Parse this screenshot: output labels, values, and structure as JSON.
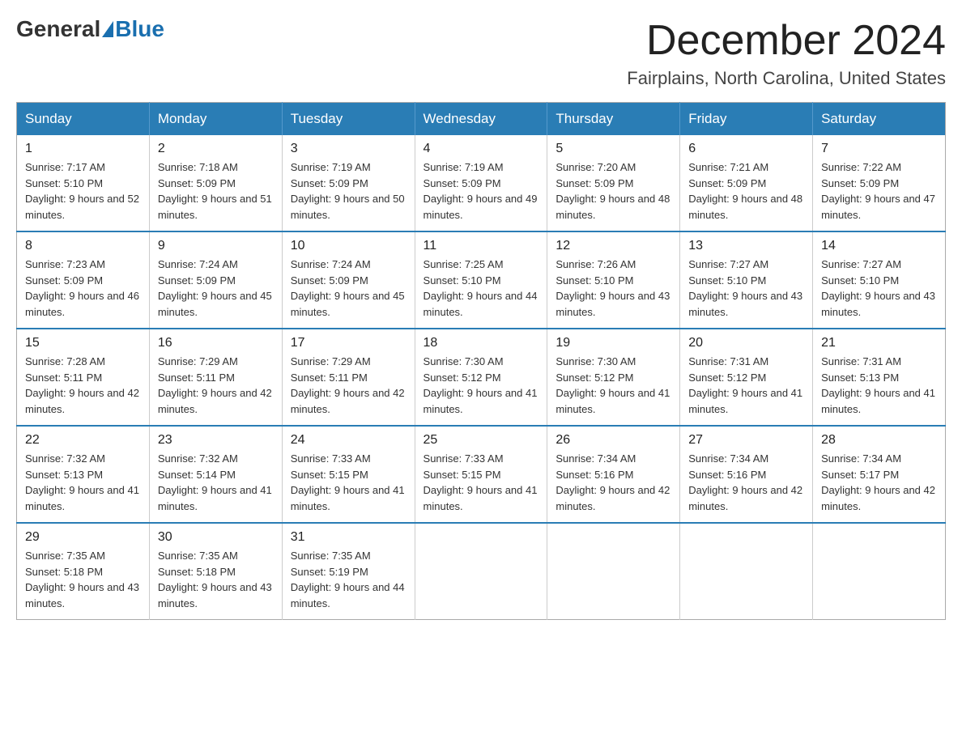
{
  "logo": {
    "general": "General",
    "blue": "Blue"
  },
  "title": {
    "month_year": "December 2024",
    "location": "Fairplains, North Carolina, United States"
  },
  "days_of_week": [
    "Sunday",
    "Monday",
    "Tuesday",
    "Wednesday",
    "Thursday",
    "Friday",
    "Saturday"
  ],
  "weeks": [
    [
      {
        "day": "1",
        "sunrise": "7:17 AM",
        "sunset": "5:10 PM",
        "daylight": "9 hours and 52 minutes."
      },
      {
        "day": "2",
        "sunrise": "7:18 AM",
        "sunset": "5:09 PM",
        "daylight": "9 hours and 51 minutes."
      },
      {
        "day": "3",
        "sunrise": "7:19 AM",
        "sunset": "5:09 PM",
        "daylight": "9 hours and 50 minutes."
      },
      {
        "day": "4",
        "sunrise": "7:19 AM",
        "sunset": "5:09 PM",
        "daylight": "9 hours and 49 minutes."
      },
      {
        "day": "5",
        "sunrise": "7:20 AM",
        "sunset": "5:09 PM",
        "daylight": "9 hours and 48 minutes."
      },
      {
        "day": "6",
        "sunrise": "7:21 AM",
        "sunset": "5:09 PM",
        "daylight": "9 hours and 48 minutes."
      },
      {
        "day": "7",
        "sunrise": "7:22 AM",
        "sunset": "5:09 PM",
        "daylight": "9 hours and 47 minutes."
      }
    ],
    [
      {
        "day": "8",
        "sunrise": "7:23 AM",
        "sunset": "5:09 PM",
        "daylight": "9 hours and 46 minutes."
      },
      {
        "day": "9",
        "sunrise": "7:24 AM",
        "sunset": "5:09 PM",
        "daylight": "9 hours and 45 minutes."
      },
      {
        "day": "10",
        "sunrise": "7:24 AM",
        "sunset": "5:09 PM",
        "daylight": "9 hours and 45 minutes."
      },
      {
        "day": "11",
        "sunrise": "7:25 AM",
        "sunset": "5:10 PM",
        "daylight": "9 hours and 44 minutes."
      },
      {
        "day": "12",
        "sunrise": "7:26 AM",
        "sunset": "5:10 PM",
        "daylight": "9 hours and 43 minutes."
      },
      {
        "day": "13",
        "sunrise": "7:27 AM",
        "sunset": "5:10 PM",
        "daylight": "9 hours and 43 minutes."
      },
      {
        "day": "14",
        "sunrise": "7:27 AM",
        "sunset": "5:10 PM",
        "daylight": "9 hours and 43 minutes."
      }
    ],
    [
      {
        "day": "15",
        "sunrise": "7:28 AM",
        "sunset": "5:11 PM",
        "daylight": "9 hours and 42 minutes."
      },
      {
        "day": "16",
        "sunrise": "7:29 AM",
        "sunset": "5:11 PM",
        "daylight": "9 hours and 42 minutes."
      },
      {
        "day": "17",
        "sunrise": "7:29 AM",
        "sunset": "5:11 PM",
        "daylight": "9 hours and 42 minutes."
      },
      {
        "day": "18",
        "sunrise": "7:30 AM",
        "sunset": "5:12 PM",
        "daylight": "9 hours and 41 minutes."
      },
      {
        "day": "19",
        "sunrise": "7:30 AM",
        "sunset": "5:12 PM",
        "daylight": "9 hours and 41 minutes."
      },
      {
        "day": "20",
        "sunrise": "7:31 AM",
        "sunset": "5:12 PM",
        "daylight": "9 hours and 41 minutes."
      },
      {
        "day": "21",
        "sunrise": "7:31 AM",
        "sunset": "5:13 PM",
        "daylight": "9 hours and 41 minutes."
      }
    ],
    [
      {
        "day": "22",
        "sunrise": "7:32 AM",
        "sunset": "5:13 PM",
        "daylight": "9 hours and 41 minutes."
      },
      {
        "day": "23",
        "sunrise": "7:32 AM",
        "sunset": "5:14 PM",
        "daylight": "9 hours and 41 minutes."
      },
      {
        "day": "24",
        "sunrise": "7:33 AM",
        "sunset": "5:15 PM",
        "daylight": "9 hours and 41 minutes."
      },
      {
        "day": "25",
        "sunrise": "7:33 AM",
        "sunset": "5:15 PM",
        "daylight": "9 hours and 41 minutes."
      },
      {
        "day": "26",
        "sunrise": "7:34 AM",
        "sunset": "5:16 PM",
        "daylight": "9 hours and 42 minutes."
      },
      {
        "day": "27",
        "sunrise": "7:34 AM",
        "sunset": "5:16 PM",
        "daylight": "9 hours and 42 minutes."
      },
      {
        "day": "28",
        "sunrise": "7:34 AM",
        "sunset": "5:17 PM",
        "daylight": "9 hours and 42 minutes."
      }
    ],
    [
      {
        "day": "29",
        "sunrise": "7:35 AM",
        "sunset": "5:18 PM",
        "daylight": "9 hours and 43 minutes."
      },
      {
        "day": "30",
        "sunrise": "7:35 AM",
        "sunset": "5:18 PM",
        "daylight": "9 hours and 43 minutes."
      },
      {
        "day": "31",
        "sunrise": "7:35 AM",
        "sunset": "5:19 PM",
        "daylight": "9 hours and 44 minutes."
      },
      null,
      null,
      null,
      null
    ]
  ]
}
